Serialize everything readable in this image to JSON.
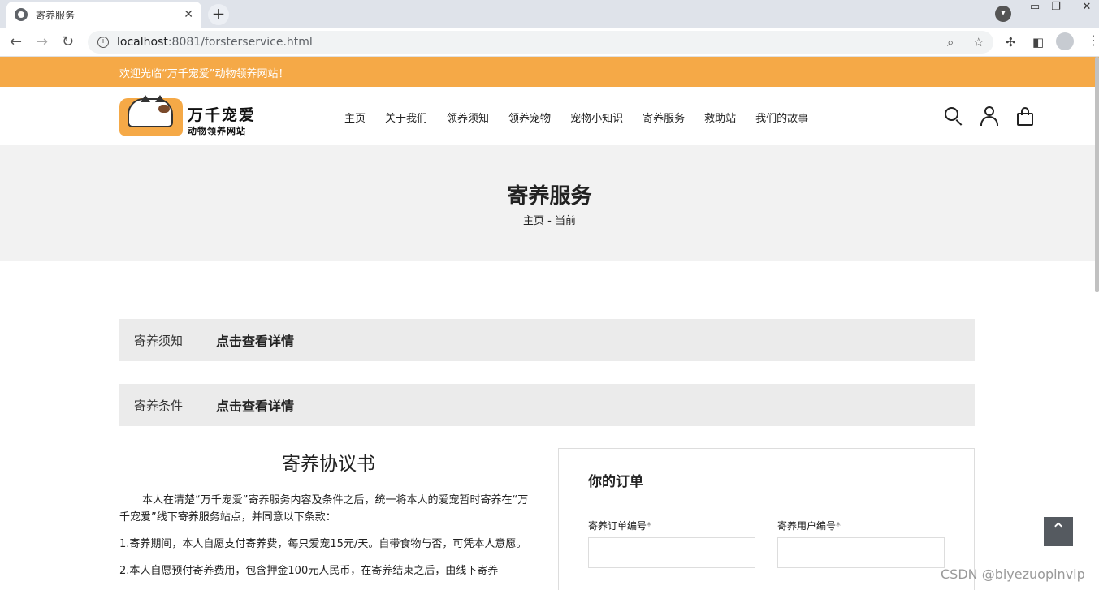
{
  "browser": {
    "tab_title": "寄养服务",
    "tab_close": "✕",
    "new_tab": "+",
    "url_host": "localhost",
    "url_rest": ":8081/forsterservice.html",
    "info_glyph": "i"
  },
  "topbar": {
    "welcome": "欢迎光临“万千宠爱”动物领养网站！"
  },
  "logo": {
    "brand_line1": "万千宠爱",
    "brand_line2": "动物领养网站"
  },
  "nav": {
    "items": [
      {
        "label": "主页"
      },
      {
        "label": "关于我们"
      },
      {
        "label": "领养须知"
      },
      {
        "label": "领养宠物"
      },
      {
        "label": "宠物小知识"
      },
      {
        "label": "寄养服务"
      },
      {
        "label": "救助站"
      },
      {
        "label": "我们的故事"
      }
    ]
  },
  "banner": {
    "title": "寄养服务",
    "crumb_home": "主页",
    "crumb_sep": "-",
    "crumb_current": "当前"
  },
  "sections": [
    {
      "label": "寄养须知",
      "link": "点击查看详情"
    },
    {
      "label": "寄养条件",
      "link": "点击查看详情"
    }
  ],
  "agreement": {
    "title": "寄养协议书",
    "p1": "本人在清楚“万千宠爱”寄养服务内容及条件之后，统一将本人的爱宠暂时寄养在“万千宠爱”线下寄养服务站点，并同意以下条款：",
    "p2": "1.寄养期间，本人自愿支付寄养费，每只爱宠15元/天。自带食物与否，可凭本人意愿。",
    "p3": "2.本人自愿预付寄养费用，包含押金100元人民币，在寄养结束之后，由线下寄养"
  },
  "order": {
    "title": "你的订单",
    "field1_label": "寄养订单编号",
    "field2_label": "寄养用户编号",
    "required_mark": "*",
    "field1_value": "",
    "field2_value": ""
  },
  "back_to_top": "⌃",
  "watermark": "CSDN @biyezuopinvip"
}
